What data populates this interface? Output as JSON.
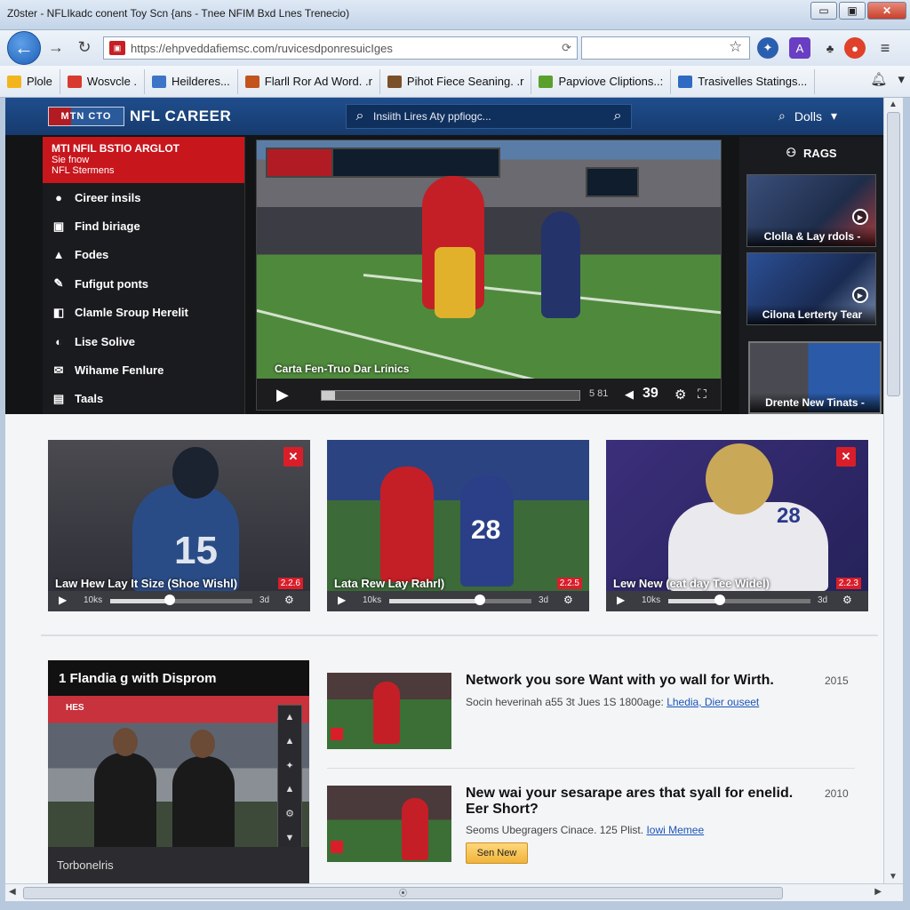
{
  "window": {
    "title": "Z0ster - NFLIkadc conent Toy Scn {ans - Tnee NFIM Bxd Lnes Trenecio)",
    "buttons": [
      "▭",
      "▣",
      "✕"
    ]
  },
  "nav": {
    "url": "https://ehpveddafiemsc.com/ruvicesdponresuicIges",
    "url_tail": "⟳",
    "search_value": ""
  },
  "bookmarks": [
    {
      "label": "Plole",
      "color": "#f2b51e"
    },
    {
      "label": "Wosvcle .",
      "color": "#d93a2f"
    },
    {
      "label": "Heilderes...",
      "color": "#3d74c7"
    },
    {
      "label": "Flarll Ror Ad Word. .r",
      "color": "#c2541c"
    },
    {
      "label": "Pihot Fiece Seaning. .r",
      "color": "#7a4f2a"
    },
    {
      "label": "Papviove Cliptions..:",
      "color": "#5aa02c"
    },
    {
      "label": "Trasivelles Statings...",
      "color": "#2f6bc2"
    }
  ],
  "site": {
    "logo_badge": "MTN CTO",
    "logo_text": "NFL CAREER",
    "search_placeholder": "Insiith Lires Aty ppfiogc...",
    "user_label": "Dolls"
  },
  "sidebar": {
    "promo": {
      "line1": "MTI NFIL BSTIO ARGLOT",
      "line2": "Sie fnow",
      "line3": "NFL Stermens"
    },
    "items": [
      {
        "icon": "●",
        "label": "Cireer insils"
      },
      {
        "icon": "▣",
        "label": "Find biriage"
      },
      {
        "icon": "▲",
        "label": "Fodes"
      },
      {
        "icon": "✎",
        "label": "Fufigut ponts"
      },
      {
        "icon": "◧",
        "label": "Clamle Sroup Herelit"
      },
      {
        "icon": "◐",
        "label": "Lise Solive"
      },
      {
        "icon": "✉",
        "label": "Wihame Fenlure"
      },
      {
        "icon": "▤",
        "label": "Taals"
      }
    ]
  },
  "player": {
    "caption": "Carta Fen-Truo Dar Lrinics",
    "time": "5 81",
    "volume_icon": "◀",
    "count": "39",
    "progress": 0.05
  },
  "right_panel": {
    "heading": "RAGS",
    "cards": [
      {
        "label": "Clolla & Lay rdols -"
      },
      {
        "label": "Cilona Lerterty Tear"
      },
      {
        "label": "Drente New Tinats -"
      }
    ]
  },
  "videos": [
    {
      "title": "Law Hew Lay It Size (Shoe Wishl)",
      "badge": "2.2.6",
      "time": "10ks",
      "dur": "3d",
      "progress": 0.42,
      "jersey": "15"
    },
    {
      "title": "Lata Rew Lay Rahrl)",
      "badge": "2.2.5",
      "time": "10ks",
      "dur": "3d",
      "progress": 0.64,
      "jersey": "28"
    },
    {
      "title": "Lew New (eat day Tee Widel)",
      "badge": "2.2.3",
      "time": "10ks",
      "dur": "3d",
      "progress": 0.36,
      "jersey": "28"
    }
  ],
  "live": {
    "heading": "1 Flandia g with Disprom",
    "banner": "HES",
    "footer": "Torbonelris",
    "controls": [
      "▲",
      "▲",
      "✦",
      "▲",
      "⚙",
      "▼"
    ]
  },
  "articles": [
    {
      "headline": "Network you sore Want with yo wall for Wirth.",
      "year": "2015",
      "meta": "Socin heverinah a55 3t Jues 1S 1800age:",
      "link": "Lhedia, Dier ouseet",
      "button": ""
    },
    {
      "headline": "New wai your sesarape ares that syall for enelid. Eer Short?",
      "year": "2010",
      "meta": "Seoms Ubegragers Cinace. 125 Plist.",
      "link": "Iowi Memee",
      "button": "Sen New"
    }
  ],
  "colors": {
    "header_blue": "#1f4d8c",
    "accent_red": "#c8161d",
    "link_blue": "#1a55b8"
  }
}
